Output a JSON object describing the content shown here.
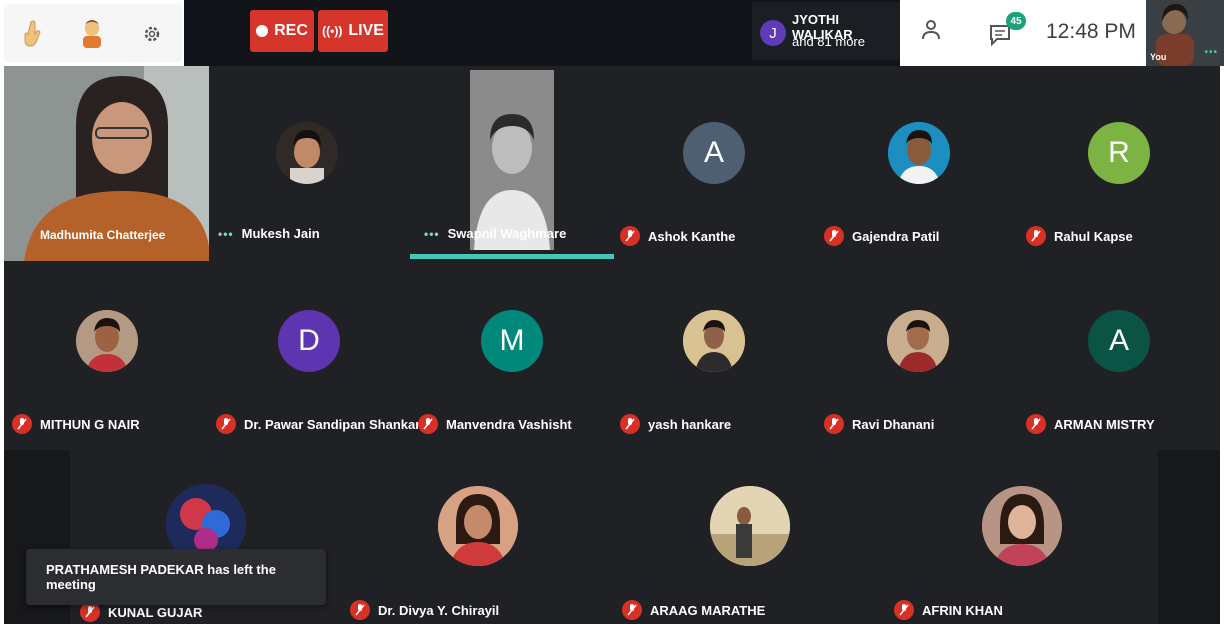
{
  "toolbar": {
    "rec_label": "REC",
    "live_label": "LIVE",
    "presenter_initial": "J",
    "presenter_name": "JYOTHI WALIKAR",
    "presenter_more": "and 81 more",
    "chat_badge": "45",
    "time": "12:48 PM",
    "self_label": "You",
    "accent_color": "#d5352b",
    "badge_color": "#1aa37a"
  },
  "participants": [
    {
      "name": "Madhumita Chatterjee",
      "type": "camera"
    },
    {
      "name": "Mukesh Jain",
      "type": "photo"
    },
    {
      "name": "Swapnil Waghmare",
      "type": "camera",
      "speaking": true
    },
    {
      "name": "Ashok Kanthe",
      "initial": "A",
      "color": "#4d5f70"
    },
    {
      "name": "Gajendra Patil",
      "type": "photo"
    },
    {
      "name": "Rahul Kapse",
      "initial": "R",
      "color": "#7cb342"
    },
    {
      "name": "MITHUN G NAIR",
      "type": "photo"
    },
    {
      "name": "Dr. Pawar Sandipan Shankar",
      "initial": "D",
      "color": "#5e35b1"
    },
    {
      "name": "Manvendra Vashisht",
      "initial": "M",
      "color": "#00897b"
    },
    {
      "name": "yash hankare",
      "type": "photo"
    },
    {
      "name": "Ravi Dhanani",
      "type": "photo"
    },
    {
      "name": "ARMAN MISTRY",
      "initial": "A",
      "color": "#0b5345"
    },
    {
      "name": "KUNAL GUJAR",
      "type": "photo"
    },
    {
      "name": "Dr. Divya Y. Chirayil",
      "type": "photo"
    },
    {
      "name": "ARAAG MARATHE",
      "type": "photo"
    },
    {
      "name": "AFRIN KHAN",
      "type": "photo"
    }
  ],
  "toast": "PRATHAMESH PADEKAR has left the meeting",
  "icons": [
    "raise-hand-icon",
    "emoji-icon",
    "settings-icon",
    "record-icon",
    "live-icon",
    "people-icon",
    "chat-icon",
    "mic-off-icon"
  ]
}
